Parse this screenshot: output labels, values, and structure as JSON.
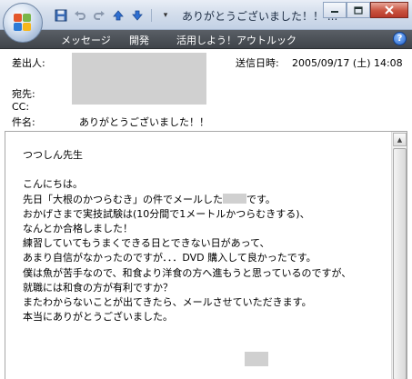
{
  "window": {
    "title": "ありがとうございました！！ ..."
  },
  "quick_access": {
    "icons": [
      "save-icon",
      "undo-icon",
      "redo-icon",
      "up-arrow-icon",
      "down-arrow-icon",
      "customize-icon"
    ]
  },
  "ribbon": {
    "tabs": [
      "メッセージ",
      "開発",
      "活用しよう！アウトルック"
    ]
  },
  "header": {
    "from_label": "差出人:",
    "sent_label": "送信日時:",
    "sent_value": "2005/09/17 (土) 14:08",
    "to_label": "宛先:",
    "cc_label": "CC:",
    "subject_label": "件名:",
    "subject_value": "ありがとうございました！！"
  },
  "message": {
    "greeting": "つつしん先生",
    "lines": [
      "こんにちは。",
      "先日「大根のかつらむき」の件でメールした",
      "おかげさまで実技試験は(10分間で1メートルかつらむきする)、",
      "なんとか合格しました！",
      "練習していてもうまくできる日とできない日があって、",
      "あまり自信がなかったのですが．．．DVD 購入して良かったです。",
      "僕は魚が苦手なので、和食より洋食の方へ進もうと思っているのですが、",
      "就職には和食の方が有利ですか？",
      "またわからないことが出てきたら、メールさせていただきます。",
      "本当にありがとうございました。"
    ],
    "line2_suffix": "です。"
  },
  "colors": {
    "ribbon_bg": "#3f444a",
    "titlebar_bg": "#d4deec",
    "redaction": "#d0d0d0",
    "close_button": "#c9533f"
  }
}
